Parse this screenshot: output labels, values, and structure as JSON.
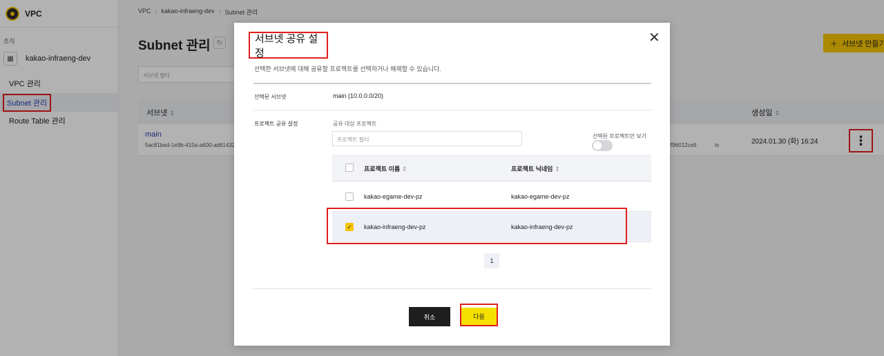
{
  "sidebar": {
    "brand": "VPC",
    "org_label": "조직",
    "org_name": "kakao-infraeng-dev",
    "items": [
      {
        "label": "VPC 관리"
      },
      {
        "label": "Subnet 관리"
      },
      {
        "label": "Route Table 관리"
      }
    ]
  },
  "breadcrumb": [
    "VPC",
    "kakao-infraeng-dev",
    "Subnet 관리"
  ],
  "page": {
    "title": "Subnet 관리",
    "filter_placeholder": "서브넷 필터",
    "create_button": "서브넷 만들기",
    "columns": {
      "subnet": "서브넷",
      "created": "생성일"
    },
    "row": {
      "name": "main",
      "id": "5ac81bed-1e9b-415a-a600-ad61432",
      "id_tail": "f12f96012ce9",
      "created": "2024.01.30 (화) 16:24"
    }
  },
  "modal": {
    "title": "서브넷 공유 설정",
    "description": "선택한 서브넷에 대해 공유할 프로젝트를 선택하거나 해제할 수 있습니다.",
    "selected_subnet_label": "선택된 서브넷",
    "selected_subnet_value": "main (10.0.0.0/20)",
    "share_label": "프로젝트 공유 설정",
    "target_label": "공유 대상 프로젝트",
    "project_filter_placeholder": "프로젝트 필터",
    "toggle_label": "선택된 프로젝트만 보기",
    "toggle_on": false,
    "columns": {
      "name": "프로젝트 이름",
      "nickname": "프로젝트 닉네임"
    },
    "projects": [
      {
        "name": "kakao-egame-dev-pz",
        "nickname": "kakao-egame-dev-pz",
        "checked": false
      },
      {
        "name": "kakao-infraeng-dev-pz",
        "nickname": "kakao-infraeng-dev-pz",
        "checked": true
      }
    ],
    "page": "1",
    "cancel_button": "취소",
    "next_button": "다음"
  },
  "colors": {
    "accent": "#f5c400",
    "highlight": "#e01d1d",
    "link": "#2b3bb0"
  }
}
